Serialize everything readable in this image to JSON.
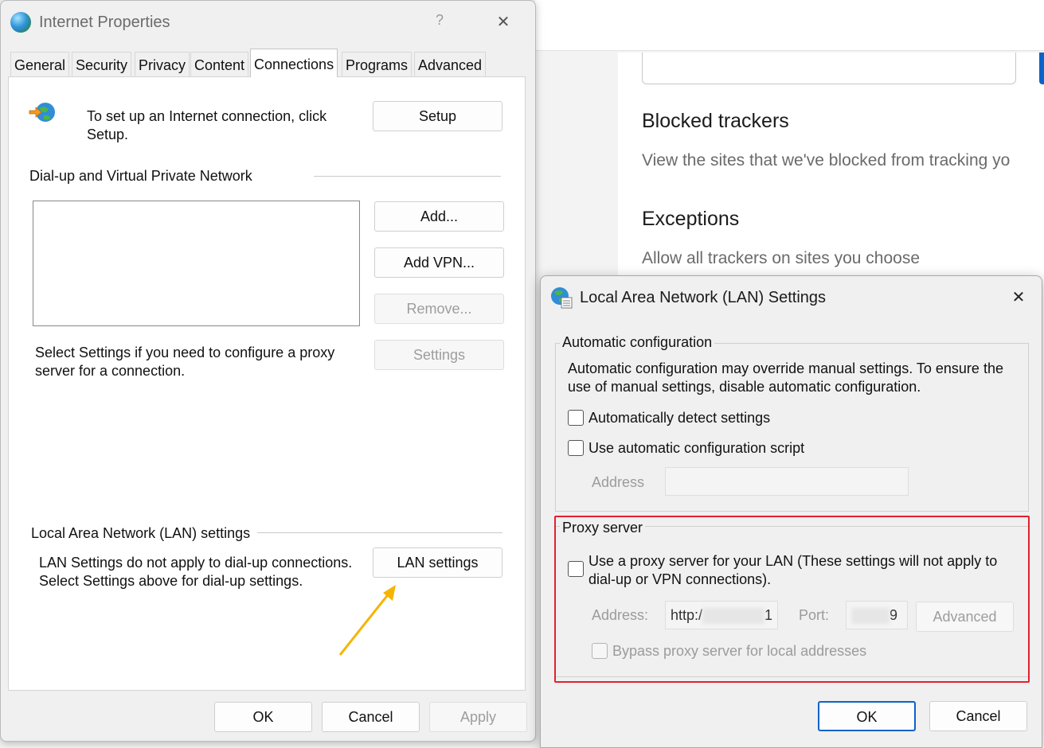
{
  "background_page": {
    "section1_title": "Blocked trackers",
    "section1_desc": "View the sites that we've blocked from tracking yo",
    "section2_title": "Exceptions",
    "section2_desc": "Allow all trackers on sites you choose",
    "accent_color": "#0a63c9"
  },
  "internet_properties": {
    "title": "Internet Properties",
    "help_label": "?",
    "close_label": "✕",
    "icon": "globe-icon",
    "tabs": [
      {
        "label": "General"
      },
      {
        "label": "Security"
      },
      {
        "label": "Privacy"
      },
      {
        "label": "Content"
      },
      {
        "label": "Connections",
        "active": true
      },
      {
        "label": "Programs"
      },
      {
        "label": "Advanced"
      }
    ],
    "setup_text": "To set up an Internet connection, click Setup.",
    "setup_button": "Setup",
    "dialup_section": "Dial-up and Virtual Private Network",
    "add_button": "Add...",
    "add_vpn_button": "Add VPN...",
    "remove_button": "Remove...",
    "settings_text": "Select Settings if you need to configure a proxy server for a connection.",
    "settings_button": "Settings",
    "lan_section": "Local Area Network (LAN) settings",
    "lan_text": "LAN Settings do not apply to dial-up connections. Select Settings above for dial-up settings.",
    "lan_button": "LAN settings",
    "ok_button": "OK",
    "cancel_button": "Cancel",
    "apply_button": "Apply",
    "annotation_color": "#f5b400"
  },
  "lan_settings": {
    "title": "Local Area Network (LAN) Settings",
    "close_label": "✕",
    "icon": "globe-settings-icon",
    "auto_config_group": "Automatic configuration",
    "auto_config_text": "Automatic configuration may override manual settings.  To ensure the use of manual settings, disable automatic configuration.",
    "auto_detect_label": "Automatically detect settings",
    "auto_detect_checked": false,
    "auto_script_label": "Use automatic configuration script",
    "auto_script_checked": false,
    "script_address_label": "Address",
    "proxy_group": "Proxy server",
    "use_proxy_label": "Use a proxy server for your LAN (These settings will not apply to dial-up or VPN connections).",
    "use_proxy_checked": false,
    "proxy_address_label": "Address:",
    "proxy_address_value_start": "http:/",
    "proxy_address_value_end": "1",
    "port_label": "Port:",
    "port_value_end": "9",
    "advanced_button": "Advanced",
    "bypass_label": "Bypass proxy server for local addresses",
    "bypass_checked": false,
    "ok_button": "OK",
    "cancel_button": "Cancel",
    "highlight_color": "#e4202d"
  }
}
